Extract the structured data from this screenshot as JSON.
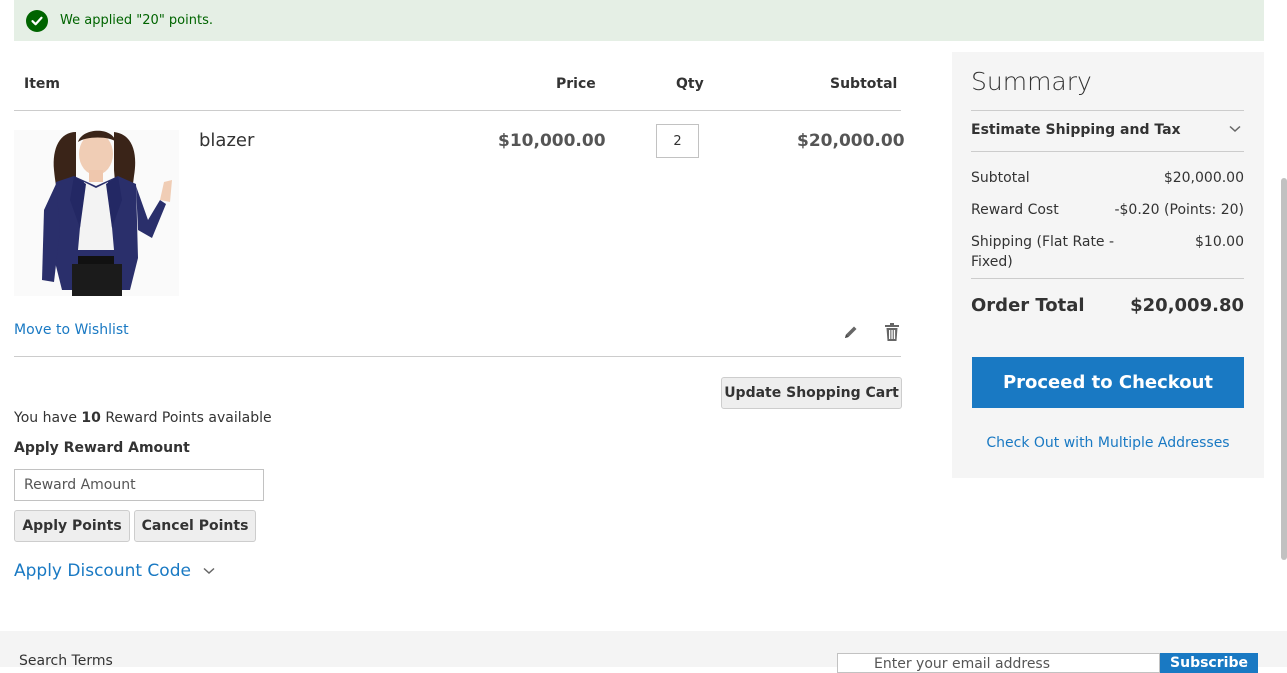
{
  "message": {
    "text": "We applied \"20\" points.",
    "icon": "check-circle-icon"
  },
  "cart": {
    "headers": {
      "item": "Item",
      "price": "Price",
      "qty": "Qty",
      "subtotal": "Subtotal"
    },
    "item": {
      "name": "blazer",
      "price": "$10,000.00",
      "qty": "2",
      "subtotal": "$20,000.00",
      "image": "blazer-product-image"
    },
    "move_to_wishlist": "Move to Wishlist",
    "update_button": "Update Shopping Cart"
  },
  "rewards": {
    "prefix": "You have ",
    "points": "10",
    "suffix": " Reward Points available",
    "label": "Apply Reward Amount",
    "placeholder": "Reward Amount",
    "apply_button": "Apply Points",
    "cancel_button": "Cancel Points"
  },
  "discount": {
    "label": "Apply Discount Code"
  },
  "summary": {
    "title": "Summary",
    "estimate": "Estimate Shipping and Tax",
    "subtotal_label": "Subtotal",
    "subtotal_value": "$20,000.00",
    "reward_label": "Reward Cost",
    "reward_value": "-$0.20 (Points: 20)",
    "shipping_label_1": "Shipping (Flat Rate -",
    "shipping_label_2": "Fixed)",
    "shipping_value": "$10.00",
    "total_label": "Order Total",
    "total_value": "$20,009.80",
    "checkout_button": "Proceed to Checkout",
    "multi_link": "Check Out with Multiple Addresses"
  },
  "footer": {
    "search_terms": "Search Terms",
    "email_placeholder": "Enter your email address",
    "subscribe": "Subscribe"
  },
  "colors": {
    "accent": "#1979c3",
    "success": "#006400",
    "success_bg": "#e5efe5"
  }
}
